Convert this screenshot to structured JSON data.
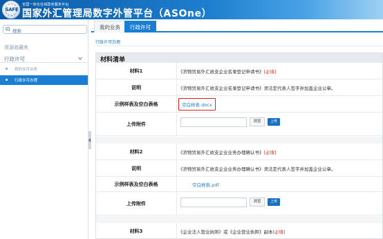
{
  "header": {
    "logo_text": "SAFE",
    "brand_small": "全国一体化在线政务服务平台",
    "title": "国家外汇管理局数字外管平台（ASOne）"
  },
  "sidebar": {
    "search_label": "搜索",
    "favorites_title": "资源收藏夹",
    "group_label": "行政许可",
    "items": [
      {
        "label": "我的许可业务"
      },
      {
        "label": "行政许可办理"
      }
    ]
  },
  "tabs": [
    {
      "label": "我的业务"
    },
    {
      "label": "行政许可"
    }
  ],
  "breadcrumb": "行政许可办理",
  "panel": {
    "title": "材料清单",
    "groups": [
      {
        "material_key": "材料1",
        "material_value": "《货物贸易外汇收支企业名录登记申请书》",
        "required": "[必填]",
        "desc_key": "说明",
        "desc_value": "《货物贸易外汇收支企业名录登记申请书》须法定代表人签字并加盖企业公章。",
        "sample_key": "示例样表及空白表格",
        "sample_link": "空白样表.docx",
        "upload_key": "上传附件",
        "browse": "浏览",
        "upload": "上传"
      },
      {
        "material_key": "材料2",
        "material_value": "《货物贸易外汇收支企业业务办理确认书》",
        "required": "[必填]",
        "desc_key": "说明",
        "desc_value": "《货物贸易外汇收支企业业务办理确认书》须法定代表人签字并加盖企业公章。",
        "sample_key": "示例样表及空白表格",
        "sample_link": "空白样表.pdf",
        "upload_key": "上传附件",
        "browse": "浏览",
        "upload": "上传"
      },
      {
        "material_key": "材料3",
        "material_value": "《企业法人营业执照》或《企业营业执照》副本",
        "required": "[必填]"
      }
    ]
  },
  "colors": {
    "accent": "#1a7fd3",
    "required": "#d03a2d",
    "highlight_border": "#d8231b"
  }
}
